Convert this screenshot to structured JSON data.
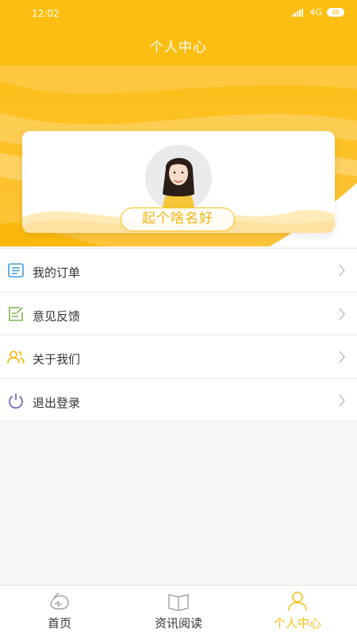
{
  "status_bar": {
    "time": "12:02",
    "network": "4G",
    "battery": "46"
  },
  "header": {
    "title": "个人中心"
  },
  "profile": {
    "nickname_button": "起个啥名好"
  },
  "menu": {
    "items": [
      {
        "label": "我的订单",
        "icon": "order-list-icon",
        "color": "#3f9bdc"
      },
      {
        "label": "意见反馈",
        "icon": "feedback-edit-icon",
        "color": "#7ab648"
      },
      {
        "label": "关于我们",
        "icon": "users-icon",
        "color": "#f5b400"
      },
      {
        "label": "退出登录",
        "icon": "power-icon",
        "color": "#6a63c8"
      }
    ]
  },
  "tabbar": {
    "tabs": [
      {
        "label": "首页",
        "icon": "home-bird-icon",
        "active": false
      },
      {
        "label": "资讯阅读",
        "icon": "book-icon",
        "active": false
      },
      {
        "label": "个人中心",
        "icon": "person-icon",
        "active": true
      }
    ]
  },
  "colors": {
    "brand": "#fcbe12",
    "text": "#333333",
    "background": "#f7f7f7"
  }
}
